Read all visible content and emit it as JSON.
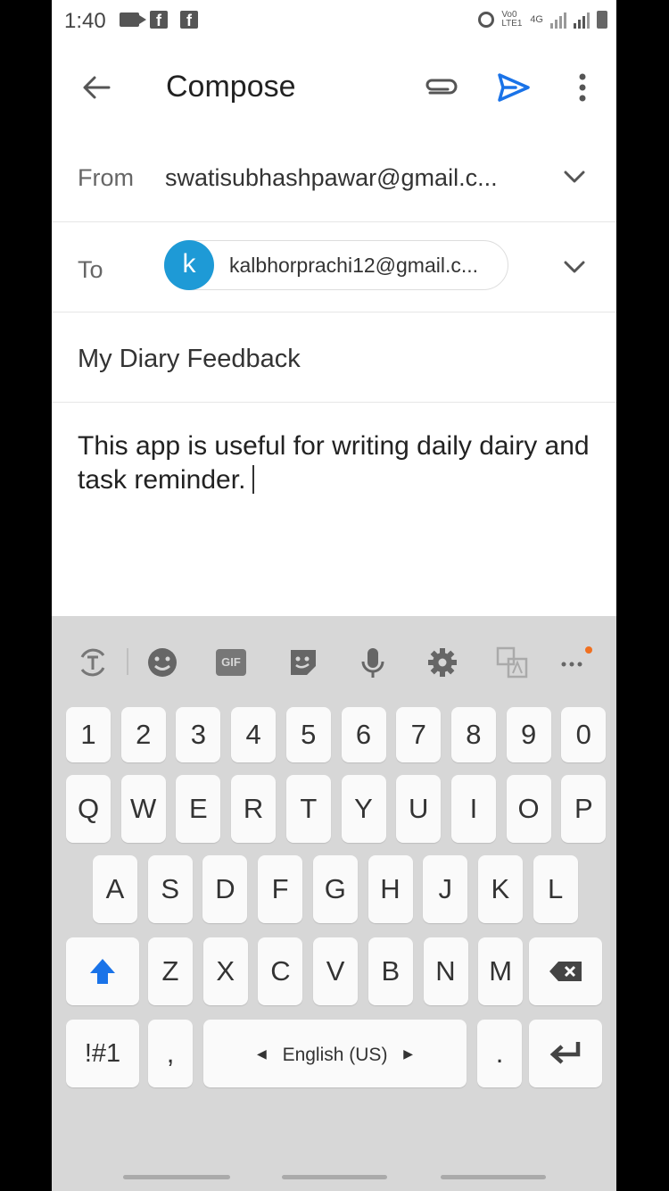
{
  "status_bar": {
    "time": "1:40",
    "net_label": "Vo0 LTE1",
    "net_label2": "4G"
  },
  "appbar": {
    "title": "Compose"
  },
  "from": {
    "label": "From",
    "value": "swatisubhashpawar@gmail.c..."
  },
  "to": {
    "label": "To",
    "avatar_letter": "k",
    "email": "kalbhorprachi12@gmail.c..."
  },
  "subject": "My Diary Feedback",
  "body": "This app is useful for writing daily dairy and task reminder.",
  "keyboard": {
    "numbers": [
      "1",
      "2",
      "3",
      "4",
      "5",
      "6",
      "7",
      "8",
      "9",
      "0"
    ],
    "row1": [
      "Q",
      "W",
      "E",
      "R",
      "T",
      "Y",
      "U",
      "I",
      "O",
      "P"
    ],
    "row2": [
      "A",
      "S",
      "D",
      "F",
      "G",
      "H",
      "J",
      "K",
      "L"
    ],
    "row3": [
      "Z",
      "X",
      "C",
      "V",
      "B",
      "N",
      "M"
    ],
    "symbols_label": "!#1",
    "comma": ",",
    "space_label": "English (US)",
    "period": ".",
    "toolbar_gif": "GIF"
  },
  "colors": {
    "accent_blue": "#1a73e8",
    "avatar_blue": "#1e9ad6",
    "keyboard_bg": "#d7d7d7"
  }
}
